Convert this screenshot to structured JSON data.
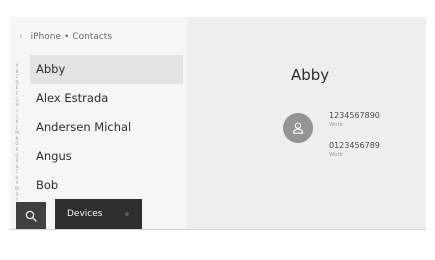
{
  "breadcrumb": {
    "back_icon": "chevron-left-icon",
    "source": "iPhone",
    "separator": "•",
    "section": "Contacts"
  },
  "alpha_index": [
    "A",
    "B",
    "C",
    "D",
    "E",
    "F",
    "G",
    "H",
    "I",
    "J",
    "K",
    "L",
    "M",
    "N",
    "O",
    "P",
    "Q",
    "R",
    "S",
    "T",
    "U",
    "V",
    "W",
    "X",
    "Y",
    "Z"
  ],
  "contacts": [
    {
      "name": "Abby"
    },
    {
      "name": "Alex Estrada"
    },
    {
      "name": "Andersen Michal"
    },
    {
      "name": "Angus"
    },
    {
      "name": "Bob"
    }
  ],
  "selected_contact": "Abby",
  "bottom_bar": {
    "search_icon": "search-icon",
    "devices_label": "Devices"
  },
  "detail": {
    "name": "Abby",
    "avatar_icon": "person-icon",
    "phones": [
      {
        "number": "1234567890",
        "type": "Work"
      },
      {
        "number": "0123456789",
        "type": "Work"
      }
    ]
  }
}
